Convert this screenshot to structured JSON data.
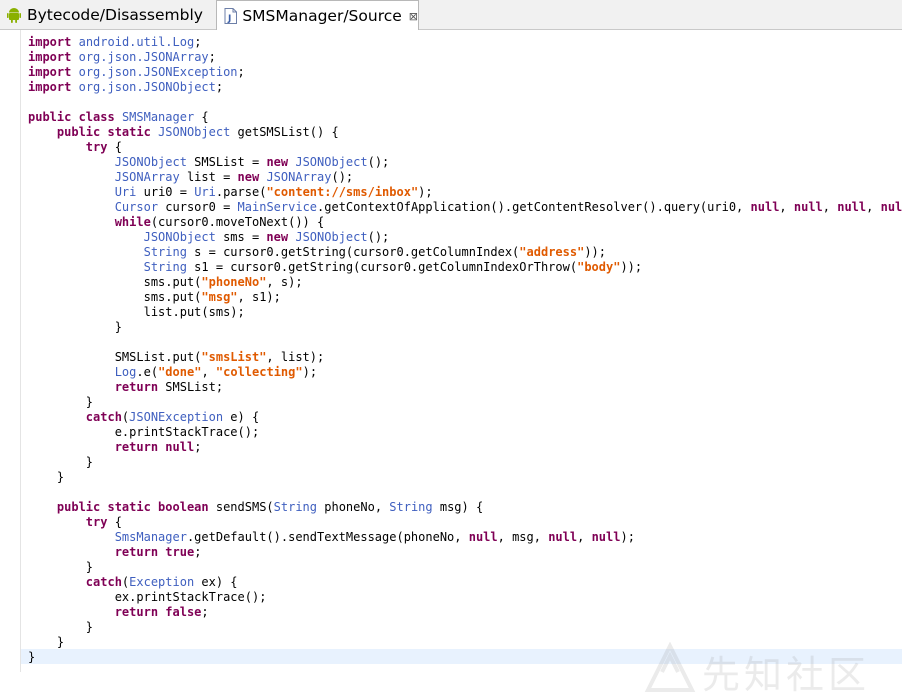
{
  "tabs": [
    {
      "label": "Bytecode/Disassembly",
      "icon": "android-icon",
      "active": false
    },
    {
      "label": "SMSManager/Source",
      "icon": "java-file-icon",
      "active": true,
      "close": "⊠"
    }
  ],
  "watermark": {
    "text": "先知社区"
  },
  "code": [
    [
      [
        "kw",
        "import"
      ],
      [
        "p",
        " "
      ],
      [
        "ty",
        "android.util.Log"
      ],
      [
        "p",
        ";"
      ]
    ],
    [
      [
        "kw",
        "import"
      ],
      [
        "p",
        " "
      ],
      [
        "ty",
        "org.json.JSONArray"
      ],
      [
        "p",
        ";"
      ]
    ],
    [
      [
        "kw",
        "import"
      ],
      [
        "p",
        " "
      ],
      [
        "ty",
        "org.json.JSONException"
      ],
      [
        "p",
        ";"
      ]
    ],
    [
      [
        "kw",
        "import"
      ],
      [
        "p",
        " "
      ],
      [
        "ty",
        "org.json.JSONObject"
      ],
      [
        "p",
        ";"
      ]
    ],
    [],
    [
      [
        "kw",
        "public class"
      ],
      [
        "p",
        " "
      ],
      [
        "ty",
        "SMSManager"
      ],
      [
        "p",
        " {"
      ]
    ],
    [
      [
        "p",
        "    "
      ],
      [
        "kw",
        "public static"
      ],
      [
        "p",
        " "
      ],
      [
        "ty",
        "JSONObject"
      ],
      [
        "p",
        " getSMSList() {"
      ]
    ],
    [
      [
        "p",
        "        "
      ],
      [
        "kw",
        "try"
      ],
      [
        "p",
        " {"
      ]
    ],
    [
      [
        "p",
        "            "
      ],
      [
        "ty",
        "JSONObject"
      ],
      [
        "p",
        " SMSList = "
      ],
      [
        "kw",
        "new"
      ],
      [
        "p",
        " "
      ],
      [
        "ty",
        "JSONObject"
      ],
      [
        "p",
        "();"
      ]
    ],
    [
      [
        "p",
        "            "
      ],
      [
        "ty",
        "JSONArray"
      ],
      [
        "p",
        " list = "
      ],
      [
        "kw",
        "new"
      ],
      [
        "p",
        " "
      ],
      [
        "ty",
        "JSONArray"
      ],
      [
        "p",
        "();"
      ]
    ],
    [
      [
        "p",
        "            "
      ],
      [
        "ty",
        "Uri"
      ],
      [
        "p",
        " uri0 = "
      ],
      [
        "ty",
        "Uri"
      ],
      [
        "p",
        ".parse("
      ],
      [
        "s",
        "\"content://sms/inbox\""
      ],
      [
        "p",
        ");"
      ]
    ],
    [
      [
        "p",
        "            "
      ],
      [
        "ty",
        "Cursor"
      ],
      [
        "p",
        " cursor0 = "
      ],
      [
        "ty",
        "MainService"
      ],
      [
        "p",
        ".getContextOfApplication().getContentResolver().query(uri0, "
      ],
      [
        "kw",
        "null"
      ],
      [
        "p",
        ", "
      ],
      [
        "kw",
        "null"
      ],
      [
        "p",
        ", "
      ],
      [
        "kw",
        "null"
      ],
      [
        "p",
        ", "
      ],
      [
        "kw",
        "null"
      ],
      [
        "p",
        ");"
      ]
    ],
    [
      [
        "p",
        "            "
      ],
      [
        "kw",
        "while"
      ],
      [
        "p",
        "(cursor0.moveToNext()) {"
      ]
    ],
    [
      [
        "p",
        "                "
      ],
      [
        "ty",
        "JSONObject"
      ],
      [
        "p",
        " sms = "
      ],
      [
        "kw",
        "new"
      ],
      [
        "p",
        " "
      ],
      [
        "ty",
        "JSONObject"
      ],
      [
        "p",
        "();"
      ]
    ],
    [
      [
        "p",
        "                "
      ],
      [
        "ty",
        "String"
      ],
      [
        "p",
        " s = cursor0.getString(cursor0.getColumnIndex("
      ],
      [
        "s",
        "\"address\""
      ],
      [
        "p",
        "));"
      ]
    ],
    [
      [
        "p",
        "                "
      ],
      [
        "ty",
        "String"
      ],
      [
        "p",
        " s1 = cursor0.getString(cursor0.getColumnIndexOrThrow("
      ],
      [
        "s",
        "\"body\""
      ],
      [
        "p",
        "));"
      ]
    ],
    [
      [
        "p",
        "                sms.put("
      ],
      [
        "s",
        "\"phoneNo\""
      ],
      [
        "p",
        ", s);"
      ]
    ],
    [
      [
        "p",
        "                sms.put("
      ],
      [
        "s",
        "\"msg\""
      ],
      [
        "p",
        ", s1);"
      ]
    ],
    [
      [
        "p",
        "                list.put(sms);"
      ]
    ],
    [
      [
        "p",
        "            }"
      ]
    ],
    [],
    [
      [
        "p",
        "            SMSList.put("
      ],
      [
        "s",
        "\"smsList\""
      ],
      [
        "p",
        ", list);"
      ]
    ],
    [
      [
        "p",
        "            "
      ],
      [
        "ty",
        "Log"
      ],
      [
        "p",
        ".e("
      ],
      [
        "s",
        "\"done\""
      ],
      [
        "p",
        ", "
      ],
      [
        "s",
        "\"collecting\""
      ],
      [
        "p",
        ");"
      ]
    ],
    [
      [
        "p",
        "            "
      ],
      [
        "kw",
        "return"
      ],
      [
        "p",
        " SMSList;"
      ]
    ],
    [
      [
        "p",
        "        }"
      ]
    ],
    [
      [
        "p",
        "        "
      ],
      [
        "kw",
        "catch"
      ],
      [
        "p",
        "("
      ],
      [
        "ty",
        "JSONException"
      ],
      [
        "p",
        " e) {"
      ]
    ],
    [
      [
        "p",
        "            e.printStackTrace();"
      ]
    ],
    [
      [
        "p",
        "            "
      ],
      [
        "kw",
        "return null"
      ],
      [
        "p",
        ";"
      ]
    ],
    [
      [
        "p",
        "        }"
      ]
    ],
    [
      [
        "p",
        "    }"
      ]
    ],
    [],
    [
      [
        "p",
        "    "
      ],
      [
        "kw",
        "public static boolean"
      ],
      [
        "p",
        " sendSMS("
      ],
      [
        "ty",
        "String"
      ],
      [
        "p",
        " phoneNo, "
      ],
      [
        "ty",
        "String"
      ],
      [
        "p",
        " msg) {"
      ]
    ],
    [
      [
        "p",
        "        "
      ],
      [
        "kw",
        "try"
      ],
      [
        "p",
        " {"
      ]
    ],
    [
      [
        "p",
        "            "
      ],
      [
        "ty",
        "SmsManager"
      ],
      [
        "p",
        ".getDefault().sendTextMessage(phoneNo, "
      ],
      [
        "kw",
        "null"
      ],
      [
        "p",
        ", msg, "
      ],
      [
        "kw",
        "null"
      ],
      [
        "p",
        ", "
      ],
      [
        "kw",
        "null"
      ],
      [
        "p",
        ");"
      ]
    ],
    [
      [
        "p",
        "            "
      ],
      [
        "kw",
        "return true"
      ],
      [
        "p",
        ";"
      ]
    ],
    [
      [
        "p",
        "        }"
      ]
    ],
    [
      [
        "p",
        "        "
      ],
      [
        "kw",
        "catch"
      ],
      [
        "p",
        "("
      ],
      [
        "ty",
        "Exception"
      ],
      [
        "p",
        " ex) {"
      ]
    ],
    [
      [
        "p",
        "            ex.printStackTrace();"
      ]
    ],
    [
      [
        "p",
        "            "
      ],
      [
        "kw",
        "return false"
      ],
      [
        "p",
        ";"
      ]
    ],
    [
      [
        "p",
        "        }"
      ]
    ],
    [
      [
        "p",
        "    }"
      ]
    ],
    [
      [
        "p",
        "}"
      ]
    ]
  ],
  "current_line": 41
}
